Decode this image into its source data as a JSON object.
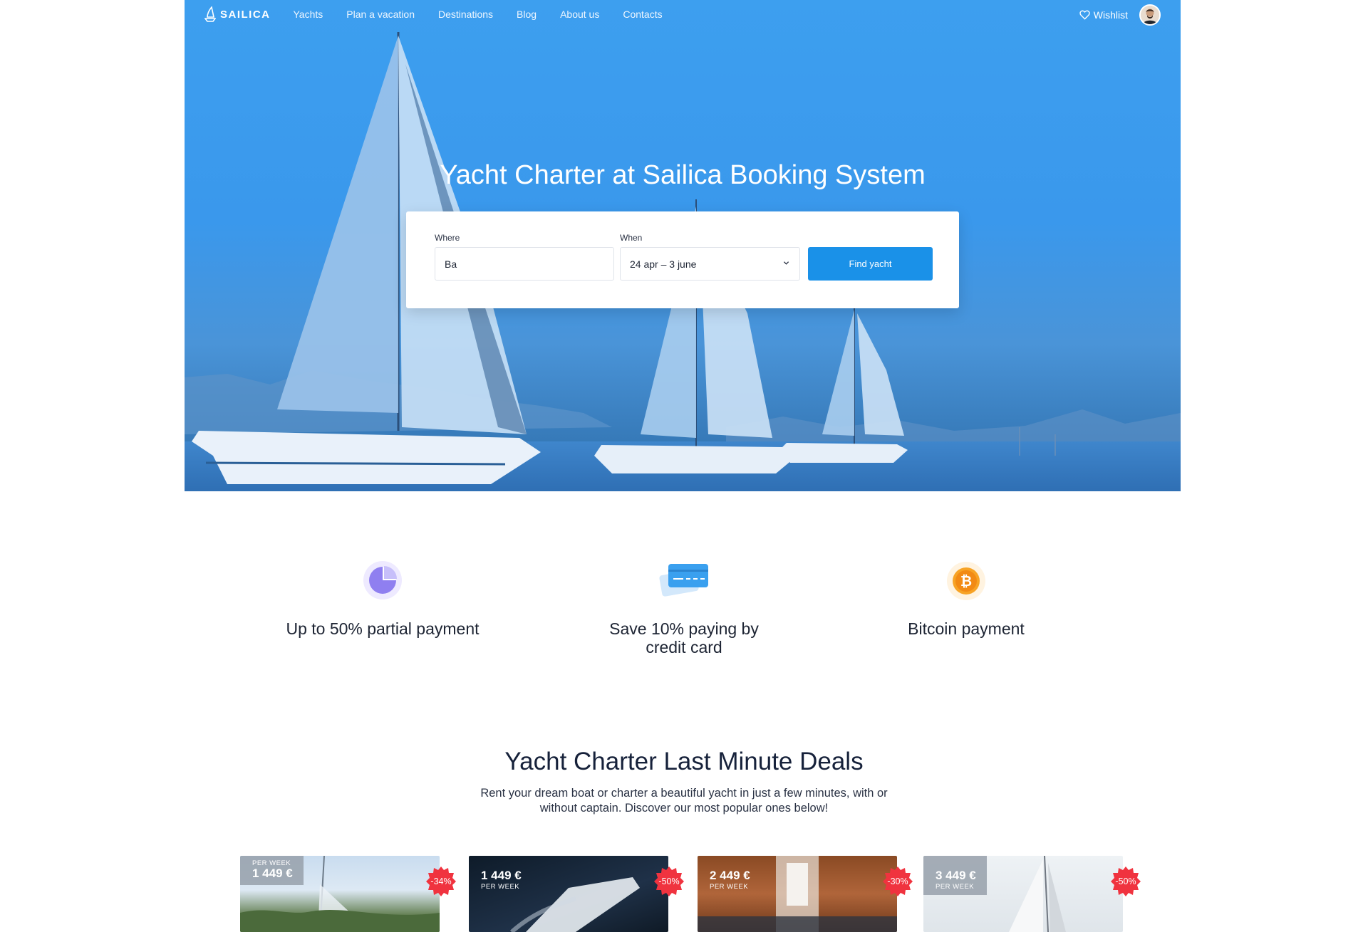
{
  "nav": {
    "brand": "SAILICA",
    "links": [
      "Yachts",
      "Plan a vacation",
      "Destinations",
      "Blog",
      "About us",
      "Contacts"
    ],
    "wishlist_label": "Wishlist"
  },
  "hero": {
    "title": "Yacht Charter at Sailica Booking System"
  },
  "search": {
    "where_label": "Where",
    "where_value": "Ba",
    "when_label": "When",
    "when_value": "24 apr – 3 june",
    "submit_label": "Find yacht"
  },
  "features": [
    {
      "icon": "pie-chart-icon",
      "text": "Up to 50% partial payment"
    },
    {
      "icon": "credit-card-icon",
      "text": "Save 10% paying by credit card"
    },
    {
      "icon": "bitcoin-icon",
      "text": "Bitcoin payment"
    }
  ],
  "deals": {
    "title": "Yacht Charter Last Minute Deals",
    "subtitle": "Rent your dream boat or charter a beautiful yacht in just a few minutes, with or without captain. Discover our most popular ones below!",
    "cards": [
      {
        "per": "PER WEEK",
        "price": "1 449 €",
        "discount": "-34%"
      },
      {
        "per": "PER WEEK",
        "price": "1 449 €",
        "discount": "-50%"
      },
      {
        "per": "PER WEEK",
        "price": "2 449 €",
        "discount": "-30%"
      },
      {
        "per": "PER WEEK",
        "price": "3 449 €",
        "discount": "-50%"
      }
    ]
  },
  "colors": {
    "primary": "#1a91e8",
    "hero_blue": "#3d9fef",
    "badge_red": "#f0333f",
    "bitcoin": "#f7931a",
    "pie_purple": "#9b8cf0"
  }
}
